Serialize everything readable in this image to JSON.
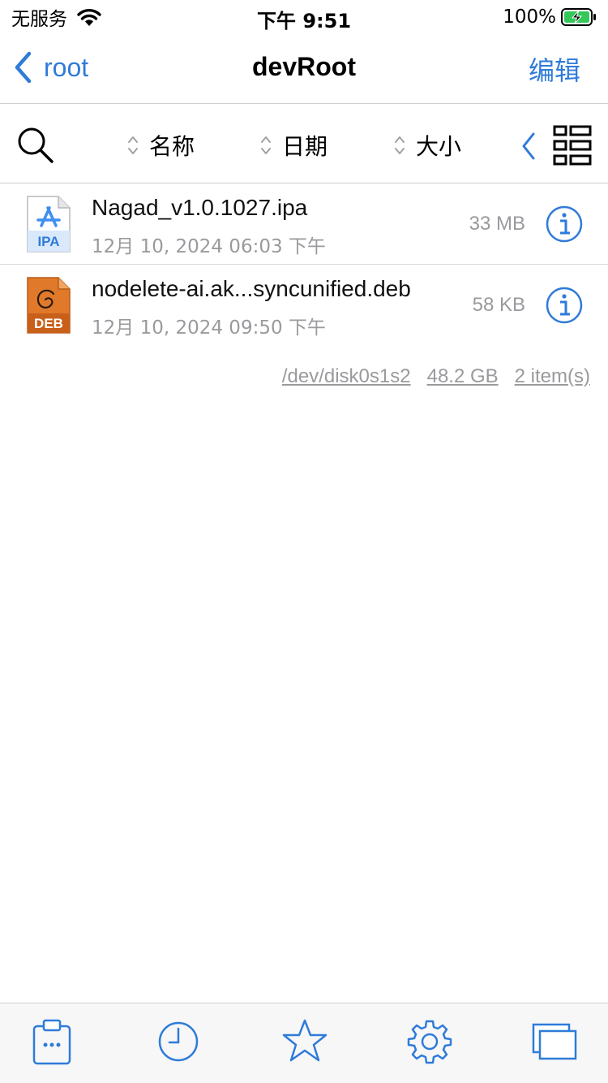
{
  "status_bar": {
    "carrier": "无服务",
    "time": "下午 9:51",
    "battery": "100%"
  },
  "nav": {
    "back_label": "root",
    "title": "devRoot",
    "edit_label": "编辑"
  },
  "toolbar": {
    "sort_name": "名称",
    "sort_date": "日期",
    "sort_size": "大小"
  },
  "files": [
    {
      "name": "Nagad_v1.0.1027.ipa",
      "date": "12月 10, 2024 06:03 下午",
      "size": "33 MB",
      "icon": "ipa-file-icon",
      "badge": "IPA"
    },
    {
      "name": "nodelete-ai.ak...syncunified.deb",
      "date": "12月 10, 2024 09:50 下午",
      "size": "58 KB",
      "icon": "deb-file-icon",
      "badge": "DEB"
    }
  ],
  "footer": {
    "device": "/dev/disk0s1s2",
    "free_space": "48.2 GB",
    "item_count": "2 item(s)"
  },
  "tab_bar": {
    "tabs": [
      "clipboard-icon",
      "history-clock-icon",
      "favorites-star-icon",
      "settings-gear-icon",
      "windows-icon"
    ]
  },
  "colors": {
    "accent": "#2f7bd9",
    "secondary_text": "#9a9a9e",
    "deb_orange": "#e07a2a"
  }
}
